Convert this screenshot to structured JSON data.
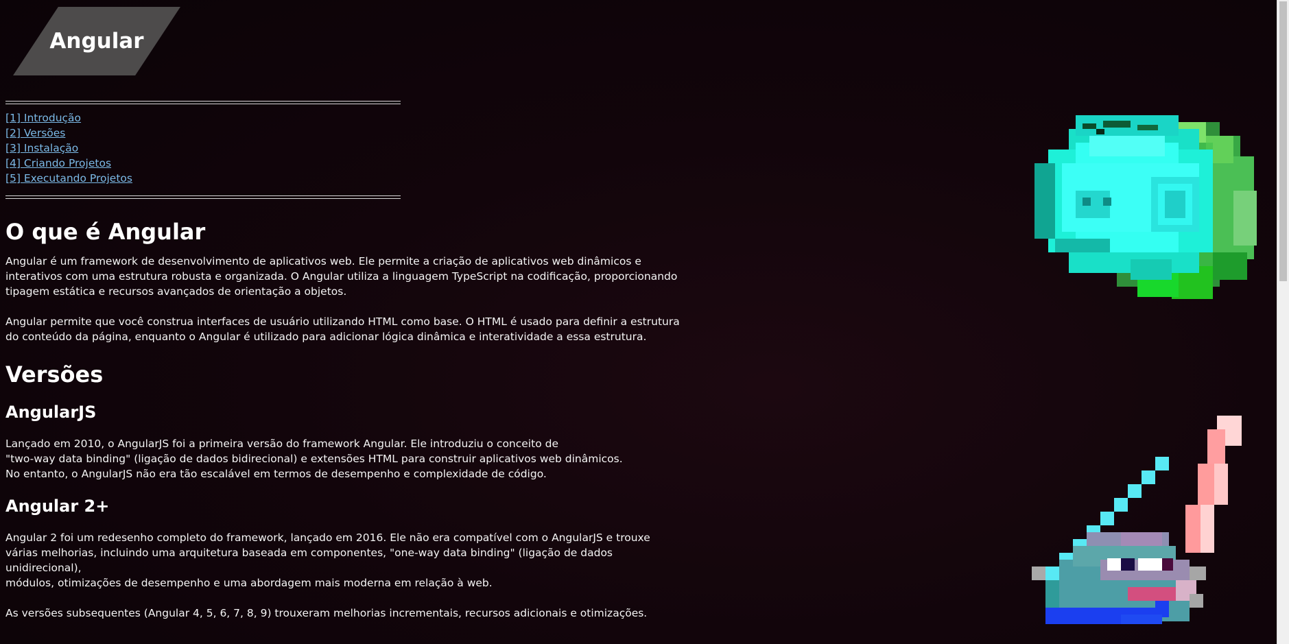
{
  "header": {
    "logo_text": "Angular"
  },
  "toc": {
    "items": [
      "[1] Introdução",
      "[2] Versões",
      "[3] Instalação",
      "[4] Criando Projetos",
      "[5] Executando Projetos"
    ]
  },
  "sections": {
    "intro_title": "O que é Angular",
    "intro_p1": "Angular é um framework de desenvolvimento de aplicativos web. Ele permite a criação de aplicativos web dinâmicos e\ninterativos com uma estrutura robusta e organizada. O Angular utiliza a linguagem TypeScript na codificação, proporcionando\ntipagem estática e recursos avançados de orientação a objetos.",
    "intro_p2": "Angular permite que você construa interfaces de usuário utilizando HTML como base. O HTML é usado para definir a estrutura\ndo conteúdo da página, enquanto o Angular é utilizado para adicionar lógica dinâmica e interatividade a essa estrutura.",
    "versions_title": "Versões",
    "angularjs_title": "AngularJS",
    "angularjs_p": "Lançado em 2010, o AngularJS foi a primeira versão do framework Angular. Ele introduziu o conceito de\n\"two-way data binding\" (ligação de dados bidirecional) e extensões HTML para construir aplicativos web dinâmicos.\nNo entanto, o AngularJS não era tão escalável em termos de desempenho e complexidade de código.",
    "angular2_title": "Angular 2+",
    "angular2_p1": "Angular 2 foi um redesenho completo do framework, lançado em 2016. Ele não era compatível com o AngularJS e trouxe\nvárias melhorias, incluindo uma arquitetura baseada em componentes, \"one-way data binding\" (ligação de dados unidirecional),\nmódulos, otimizações de desempenho e uma abordagem mais moderna em relação à web.",
    "angular2_p2": "As versões subsequentes (Angular 4, 5, 6, 7, 8, 9) trouxeram melhorias incrementais, recursos adicionais e otimizações."
  },
  "icons": {
    "art_top": "pixel-slime-icon",
    "art_bottom": "pixel-swords-creature-icon"
  },
  "colors": {
    "link": "#7bb9e6",
    "logo_bg": "#4d4b4b",
    "background": "#12050b"
  }
}
